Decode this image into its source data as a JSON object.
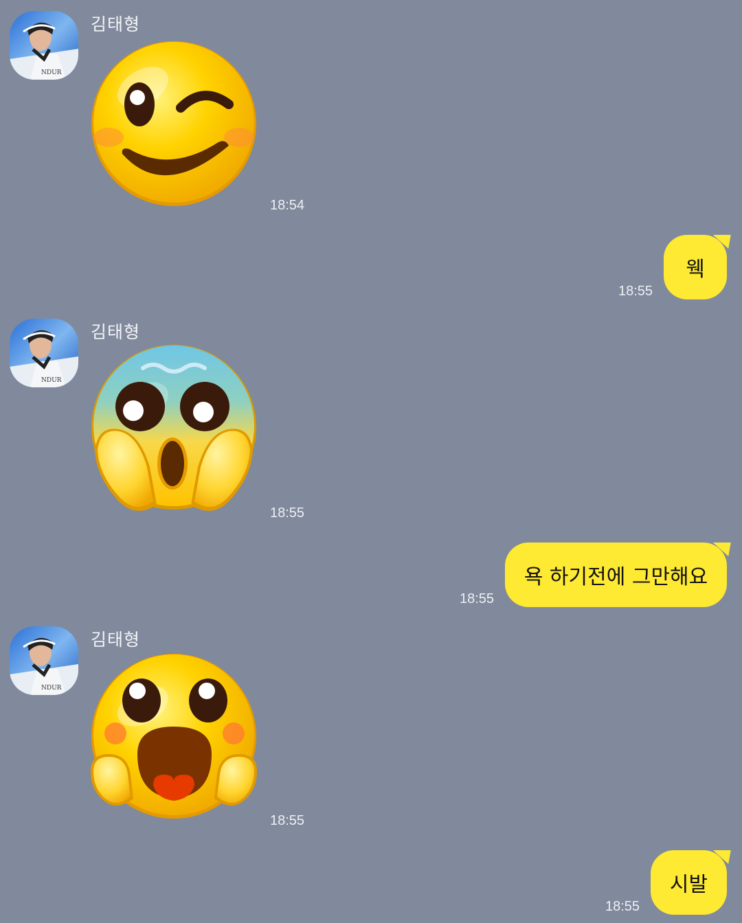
{
  "colors": {
    "background": "#808a9c",
    "my_bubble": "#fee933",
    "text_light": "#f4f5f7"
  },
  "messages": [
    {
      "side": "received",
      "sender": "김태형",
      "type": "emoticon",
      "emoticon": "winking-face-icon",
      "time": "18:54"
    },
    {
      "side": "sent",
      "type": "text",
      "text": "웩",
      "time": "18:55"
    },
    {
      "side": "received",
      "sender": "김태형",
      "type": "emoticon",
      "emoticon": "screaming-in-fear-face-icon",
      "time": "18:55"
    },
    {
      "side": "sent",
      "type": "text",
      "text": "욕 하기전에 그만해요",
      "time": "18:55"
    },
    {
      "side": "received",
      "sender": "김태형",
      "type": "emoticon",
      "emoticon": "astonished-face-icon",
      "time": "18:55"
    },
    {
      "side": "sent",
      "type": "text",
      "text": "시발",
      "time": "18:55"
    }
  ]
}
